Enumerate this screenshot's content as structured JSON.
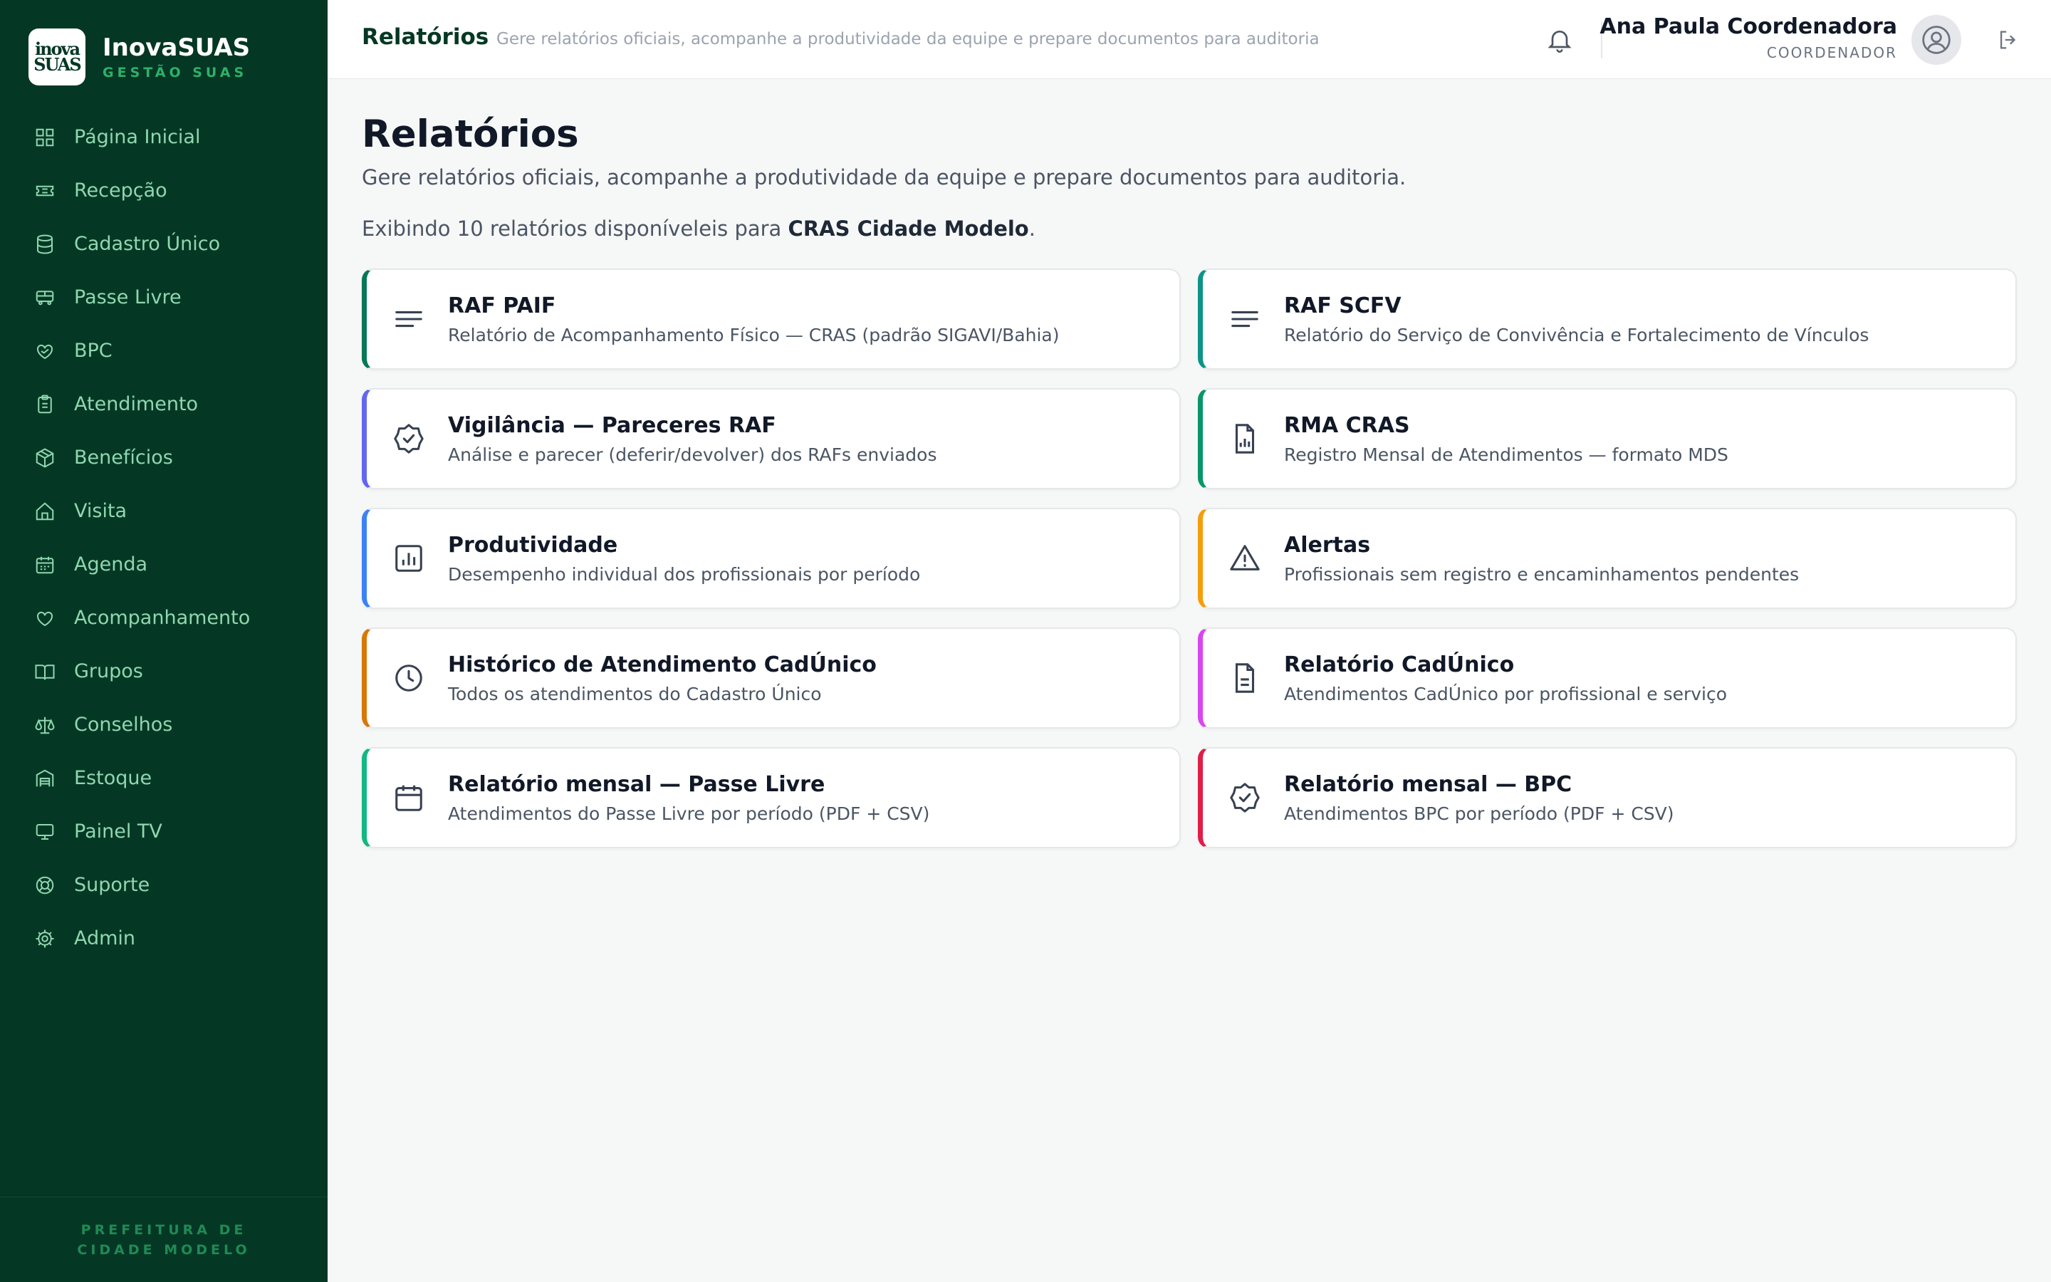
{
  "brand": {
    "logo_line1": "inova",
    "logo_line2": "SUAS",
    "name": "InovaSUAS",
    "subtitle": "GESTÃO SUAS"
  },
  "sidebar": {
    "items": [
      {
        "label": "Página Inicial",
        "icon": "grid-icon"
      },
      {
        "label": "Recepção",
        "icon": "ticket-icon"
      },
      {
        "label": "Cadastro Único",
        "icon": "database-icon"
      },
      {
        "label": "Passe Livre",
        "icon": "bus-icon"
      },
      {
        "label": "BPC",
        "icon": "heart-hand-icon"
      },
      {
        "label": "Atendimento",
        "icon": "clipboard-icon"
      },
      {
        "label": "Benefícios",
        "icon": "package-icon"
      },
      {
        "label": "Visita",
        "icon": "home-icon"
      },
      {
        "label": "Agenda",
        "icon": "calendar-icon"
      },
      {
        "label": "Acompanhamento",
        "icon": "heart-icon"
      },
      {
        "label": "Grupos",
        "icon": "book-icon"
      },
      {
        "label": "Conselhos",
        "icon": "scale-icon"
      },
      {
        "label": "Estoque",
        "icon": "warehouse-icon"
      },
      {
        "label": "Painel TV",
        "icon": "monitor-icon"
      },
      {
        "label": "Suporte",
        "icon": "lifebuoy-icon"
      },
      {
        "label": "Admin",
        "icon": "gear-icon"
      }
    ],
    "footer": "PREFEITURA DE CIDADE MODELO"
  },
  "header": {
    "title": "Relatórios",
    "subtitle": "Gere relatórios oficiais, acompanhe a produtividade da equipe e prepare documentos para auditoria",
    "user_name": "Ana Paula Coordenadora",
    "user_role": "COORDENADOR"
  },
  "main": {
    "title": "Relatórios",
    "description": "Gere relatórios oficiais, acompanhe a produtividade da equipe e prepare documentos para auditoria.",
    "count_prefix": "Exibindo 10 relatórios disponíveleis para ",
    "count_unit": "CRAS Cidade Modelo",
    "count_suffix": "."
  },
  "cards": [
    {
      "title": "RAF PAIF",
      "desc": "Relatório de Acompanhamento Físico — CRAS (padrão SIGAVI/Bahia)",
      "icon": "lines-icon",
      "color": "#047857"
    },
    {
      "title": "RAF SCFV",
      "desc": "Relatório do Serviço de Convivência e Fortalecimento de Vínculos",
      "icon": "lines-icon",
      "color": "#0d9488"
    },
    {
      "title": "Vigilância — Pareceres RAF",
      "desc": "Análise e parecer (deferir/devolver) dos RAFs enviados",
      "icon": "badge-check-icon",
      "color": "#6366f1"
    },
    {
      "title": "RMA CRAS",
      "desc": "Registro Mensal de Atendimentos — formato MDS",
      "icon": "file-chart-icon",
      "color": "#059669"
    },
    {
      "title": "Produtividade",
      "desc": "Desempenho individual dos profissionais por período",
      "icon": "bar-chart-icon",
      "color": "#3b82f6"
    },
    {
      "title": "Alertas",
      "desc": "Profissionais sem registro e encaminhamentos pendentes",
      "icon": "alert-triangle-icon",
      "color": "#f59e0b"
    },
    {
      "title": "Histórico de Atendimento CadÚnico",
      "desc": "Todos os atendimentos do Cadastro Único",
      "icon": "clock-icon",
      "color": "#d97706"
    },
    {
      "title": "Relatório CadÚnico",
      "desc": "Atendimentos CadÚnico por profissional e serviço",
      "icon": "file-text-icon",
      "color": "#d946ef"
    },
    {
      "title": "Relatório mensal — Passe Livre",
      "desc": "Atendimentos do Passe Livre por período (PDF + CSV)",
      "icon": "calendar-icon",
      "color": "#10b981"
    },
    {
      "title": "Relatório mensal — BPC",
      "desc": "Atendimentos BPC por período (PDF + CSV)",
      "icon": "badge-check-icon",
      "color": "#e11d48"
    }
  ]
}
